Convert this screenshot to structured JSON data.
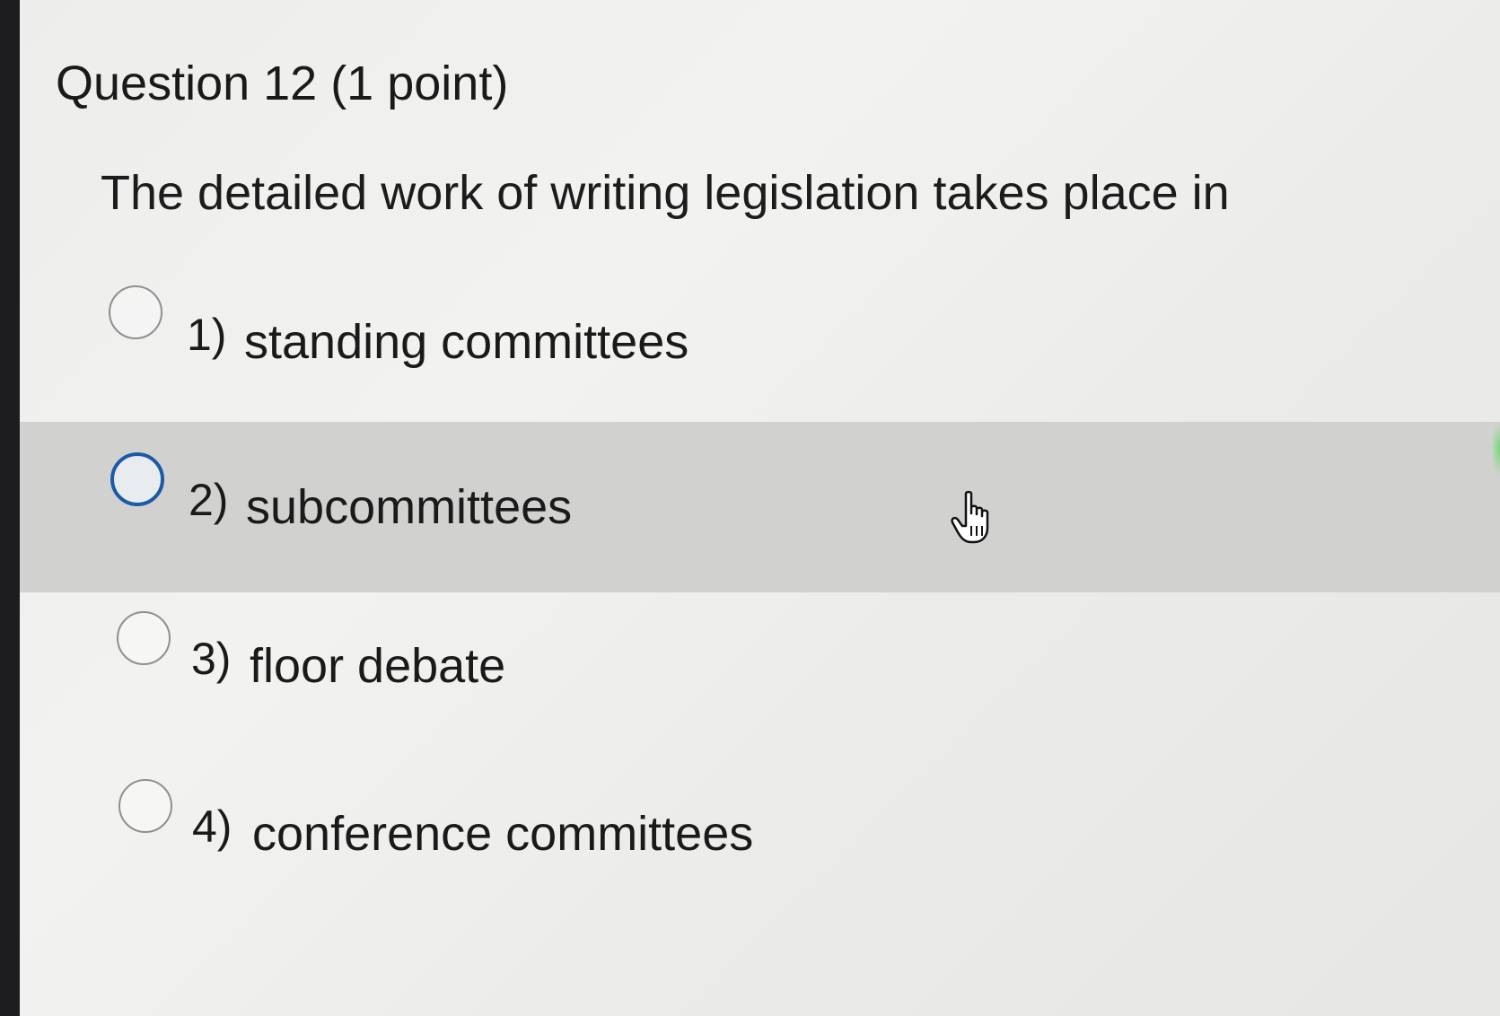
{
  "question": {
    "title": "Question 12 (1 point)",
    "prompt": "The detailed work of writing legislation takes place in"
  },
  "options": [
    {
      "number": "1)",
      "label": "standing committees",
      "state": "unselected"
    },
    {
      "number": "2)",
      "label": "subcommittees",
      "state": "hovered"
    },
    {
      "number": "3)",
      "label": "floor debate",
      "state": "unselected"
    },
    {
      "number": "4)",
      "label": "conference committees",
      "state": "unselected"
    }
  ],
  "cursor": {
    "icon": "hand-pointer-icon"
  },
  "colors": {
    "hover_background": "#d1d2d0",
    "hover_radio_border": "#1a5aa6",
    "radio_border": "#8f8f8f",
    "text": "#1a1a1a"
  }
}
